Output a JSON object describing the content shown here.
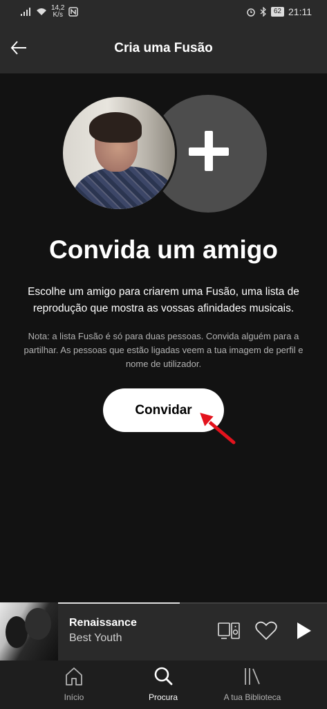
{
  "status_bar": {
    "network_speed_value": "14,2",
    "network_speed_unit": "K/s",
    "battery": "62",
    "time": "21:11"
  },
  "app_bar": {
    "title": "Cria uma Fusão"
  },
  "main": {
    "heading": "Convida um amigo",
    "description": "Escolhe um amigo para criarem uma Fusão, uma lista de reprodução que mostra as vossas afinidades musicais.",
    "note": "Nota: a lista Fusão é só para duas pessoas. Convida alguém para a partilhar. As pessoas que estão ligadas veem a tua imagem de perfil e nome de utilizador.",
    "invite_button": "Convidar"
  },
  "mini_player": {
    "track_title": "Renaissance",
    "artist": "Best Youth",
    "progress": 0.55
  },
  "bottom_nav": {
    "items": [
      {
        "label": "Início",
        "icon": "home-icon",
        "active": false
      },
      {
        "label": "Procura",
        "icon": "search-icon",
        "active": true
      },
      {
        "label": "A tua Biblioteca",
        "icon": "library-icon",
        "active": false
      }
    ]
  },
  "colors": {
    "background": "#121212",
    "bar": "#2a2a2a",
    "accent_arrow": "#e3131d"
  }
}
